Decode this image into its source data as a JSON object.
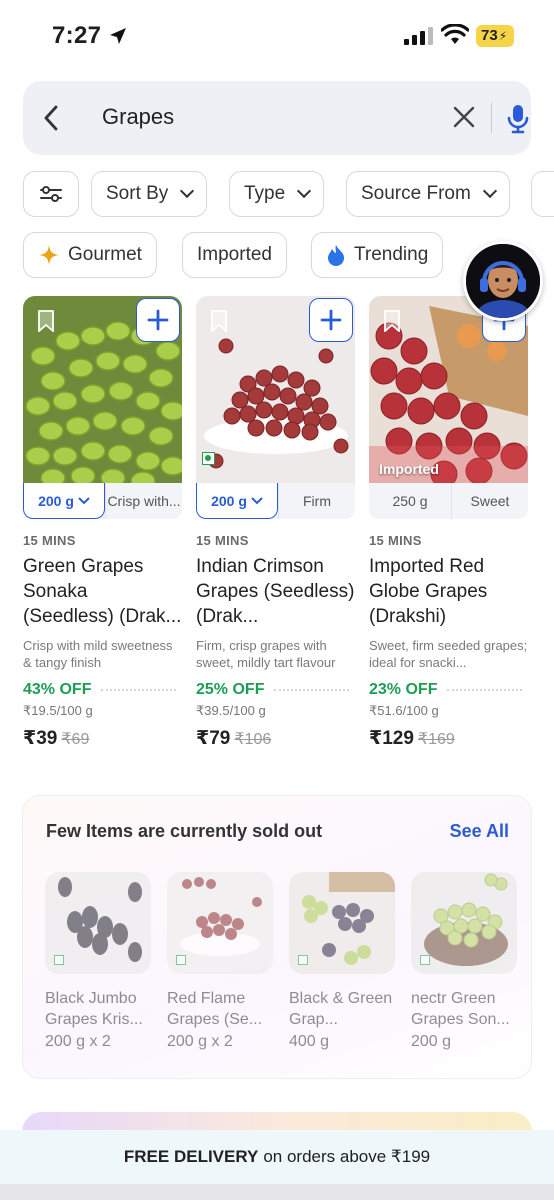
{
  "status_bar": {
    "time": "7:27",
    "battery": "73"
  },
  "search": {
    "query": "Grapes"
  },
  "filters": [
    {
      "label": "Sort By"
    },
    {
      "label": "Type"
    },
    {
      "label": "Source From"
    }
  ],
  "tags": [
    {
      "label": "Gourmet"
    },
    {
      "label": "Imported"
    },
    {
      "label": "Trending"
    }
  ],
  "products": [
    {
      "variant_selected": "200 g",
      "variant_other": "Crisp with...",
      "eta": "15 MINS",
      "name": "Green Grapes Sonaka (Seedless) (Drak...",
      "desc": "Crisp with mild sweetness & tangy finish",
      "discount": "43% OFF",
      "unit_price": "₹19.5/100 g",
      "price": "₹39",
      "mrp": "₹69",
      "tag": ""
    },
    {
      "variant_selected": "200 g",
      "variant_other": "Firm",
      "eta": "15 MINS",
      "name": "Indian Crimson Grapes (Seedless) (Drak...",
      "desc": "Firm, crisp grapes with sweet, mildly tart flavour",
      "discount": "25% OFF",
      "unit_price": "₹39.5/100 g",
      "price": "₹79",
      "mrp": "₹106",
      "tag": ""
    },
    {
      "variant_selected": "250 g",
      "variant_other": "Sweet",
      "eta": "15 MINS",
      "name": "Imported Red Globe Grapes (Drakshi)",
      "desc": "Sweet, firm seeded grapes; ideal for snacki...",
      "discount": "23% OFF",
      "unit_price": "₹51.6/100 g",
      "price": "₹129",
      "mrp": "₹169",
      "tag": "Imported"
    }
  ],
  "sold_out": {
    "title": "Few Items are currently sold out",
    "see_all": "See All",
    "items": [
      {
        "name": "Black Jumbo Grapes Kris...",
        "qty": "200 g x 2"
      },
      {
        "name": "Red Flame Grapes (Se...",
        "qty": "200 g x 2"
      },
      {
        "name": "Black & Green Grap...",
        "qty": "400 g"
      },
      {
        "name": "nectr Green Grapes Son...",
        "qty": "200 g"
      }
    ]
  },
  "delivery_banner": {
    "bold": "FREE DELIVERY",
    "rest": "on orders above ₹199"
  }
}
